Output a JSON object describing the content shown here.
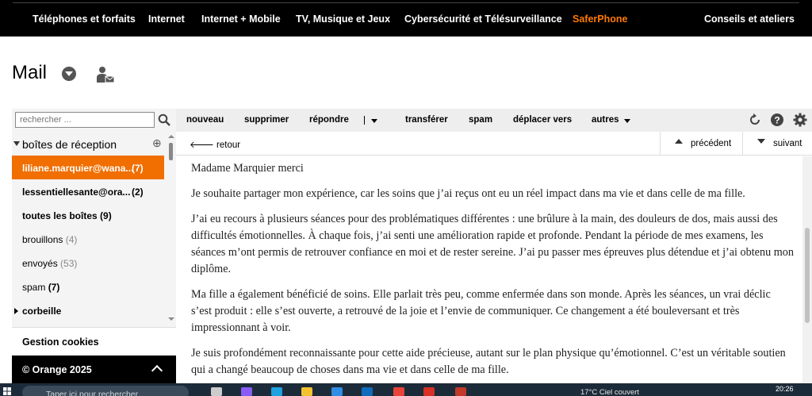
{
  "top_nav": {
    "items": [
      "Téléphones et forfaits",
      "Internet",
      "Internet + Mobile",
      "TV, Musique et Jeux",
      "Cybersécurité et Télésurveillance",
      "SaferPhone",
      "Conseils et ateliers"
    ],
    "accent_color": "#ff7900"
  },
  "header": {
    "title": "Mail",
    "icons": [
      "caret-down-icon",
      "contact-mail-icon"
    ]
  },
  "sidebar": {
    "search_placeholder": "rechercher ...",
    "inbox_header": "boîtes de réception",
    "accounts": [
      {
        "name": "liliane.marquier@wana...",
        "count": "(7)"
      },
      {
        "name": "lessentiellesante@ora...",
        "count": "(2)"
      },
      {
        "name": "toutes les boîtes",
        "count": "(9)"
      }
    ],
    "folders": [
      {
        "name": "brouillons",
        "count": "(4)"
      },
      {
        "name": "envoyés",
        "count": "(53)"
      },
      {
        "name": "spam",
        "count": "(7)"
      },
      {
        "name": "corbeille",
        "count": ""
      }
    ],
    "cookies_label": "Gestion cookies",
    "footer_label": "© Orange 2025",
    "selected_color": "#f16e00"
  },
  "toolbar": {
    "nouveau": "nouveau",
    "supprimer": "supprimer",
    "repondre": "répondre",
    "transferer": "transférer",
    "spam": "spam",
    "deplacer": "déplacer vers",
    "autres": "autres",
    "icons": [
      "refresh-icon",
      "help-icon",
      "settings-icon"
    ]
  },
  "message_nav": {
    "retour": "retour",
    "precedent": "précédent",
    "suivant": "suivant"
  },
  "message": {
    "paragraphs": [
      "Madame Marquier merci",
      "Je souhaite partager mon expérience, car les soins que j’ai reçus ont eu un réel impact dans ma vie et dans celle de ma fille.",
      "J’ai eu recours à plusieurs séances pour des problématiques différentes : une brûlure à la main, des douleurs de dos, mais aussi des difficultés émotionnelles. À chaque fois, j’ai senti une amélioration rapide et profonde. Pendant la période de mes examens, les séances m’ont permis de retrouver confiance en moi et de rester sereine. J’ai pu passer mes épreuves plus détendue et j’ai obtenu mon diplôme.",
      "Ma fille a également bénéficié de soins. Elle parlait très peu, comme enfermée dans son monde. Après les séances, un vrai déclic s’est produit : elle s’est ouverte, a retrouvé de la joie et l’envie de communiquer. Ce changement a été bouleversant et très impressionnant à voir.",
      "Je suis profondément reconnaissante pour cette aide précieuse, autant sur le plan physique qu’émotionnel. C’est un véritable soutien qui a changé beaucoup de choses dans ma vie et dans celle de ma fille."
    ]
  },
  "taskbar": {
    "search_placeholder": "Taper ici pour rechercher",
    "weather": "17°C  Ciel couvert",
    "time": "20:26"
  }
}
